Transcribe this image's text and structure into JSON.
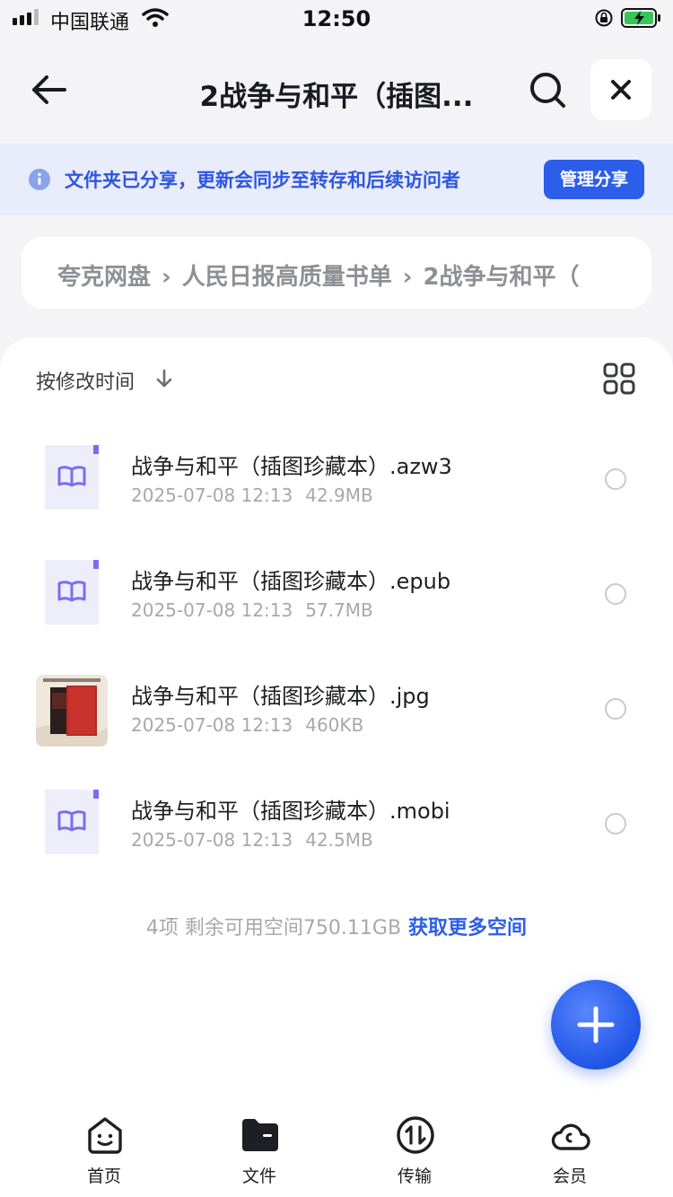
{
  "status_bar": {
    "carrier": "中国联通",
    "time": "12:50"
  },
  "header": {
    "title": "2战争与和平（插图...",
    "back_icon": "arrow-left-icon",
    "search_icon": "search-icon",
    "close_icon": "close-icon"
  },
  "banner": {
    "text": "文件夹已分享，更新会同步至转存和后续访问者",
    "button_label": "管理分享",
    "accent": "#2c5ee9"
  },
  "breadcrumb": {
    "items": [
      "夸克网盘",
      "人民日报高质量书单",
      "2战争与和平（"
    ]
  },
  "toolbar": {
    "sort_label": "按修改时间",
    "sort_icon": "arrow-down-icon",
    "view_icon": "grid-view-icon"
  },
  "files": [
    {
      "name": "战争与和平（插图珍藏本）.azw3",
      "date": "2025-07-08 12:13",
      "size": "42.9MB",
      "icon": "book-file-icon"
    },
    {
      "name": "战争与和平（插图珍藏本）.epub",
      "date": "2025-07-08 12:13",
      "size": "57.7MB",
      "icon": "book-file-icon"
    },
    {
      "name": "战争与和平（插图珍藏本）.jpg",
      "date": "2025-07-08 12:13",
      "size": "460KB",
      "icon": "image-thumbnail"
    },
    {
      "name": "战争与和平（插图珍藏本）.mobi",
      "date": "2025-07-08 12:13",
      "size": "42.5MB",
      "icon": "book-file-icon"
    }
  ],
  "footer": {
    "summary": "4项 剩余可用空间750.11GB",
    "link": "获取更多空间"
  },
  "tabs": [
    {
      "label": "首页",
      "icon": "home-face-icon"
    },
    {
      "label": "文件",
      "icon": "folder-icon"
    },
    {
      "label": "传输",
      "icon": "transfer-icon"
    },
    {
      "label": "会员",
      "icon": "cloud-icon"
    }
  ]
}
